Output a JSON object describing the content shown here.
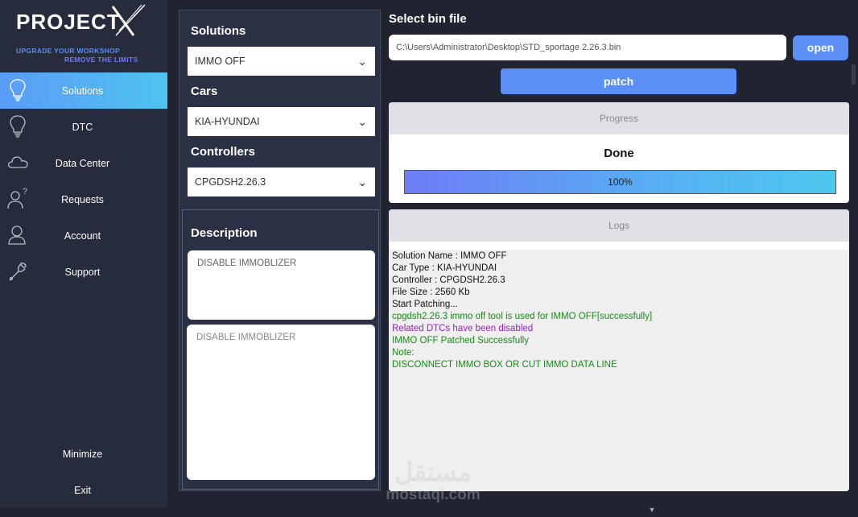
{
  "brand": {
    "title": "PROJECT",
    "tagline1": "UPGRADE YOUR WORKSHOP",
    "tagline2": "REMOVE THE LIMITS",
    "accent": "#5b8ff7"
  },
  "sidebar": {
    "items": [
      {
        "label": "Solutions",
        "icon": "lightbulb-icon",
        "active": true
      },
      {
        "label": "DTC",
        "icon": "lightbulb-icon"
      },
      {
        "label": "Data Center",
        "icon": "cloud-icon"
      },
      {
        "label": "Requests",
        "icon": "user-question-icon"
      },
      {
        "label": "Account",
        "icon": "user-icon"
      },
      {
        "label": "Support",
        "icon": "wrench-icon"
      }
    ],
    "minimize_label": "Minimize",
    "exit_label": "Exit"
  },
  "form": {
    "solutions_label": "Solutions",
    "solutions_value": "IMMO OFF",
    "cars_label": "Cars",
    "cars_value": "KIA-HYUNDAI",
    "controllers_label": "Controllers",
    "controllers_value": "CPGDSH2.26.3",
    "description_label": "Description",
    "description_1": "DISABLE IMMOBLIZER",
    "description_2": "DISABLE IMMOBLIZER"
  },
  "bin": {
    "label": "Select bin file",
    "path": "C:\\Users\\Administrator\\Desktop\\STD_sportage 2.26.3.bin",
    "open_label": "open",
    "patch_label": "patch"
  },
  "progress": {
    "header": "Progress",
    "status": "Done",
    "percent_label": "100%",
    "value": 1.0
  },
  "logs": {
    "header": "Logs",
    "lines": [
      {
        "text": "Solution Name : IMMO OFF",
        "color": "#111111"
      },
      {
        "text": "Car Type : KIA-HYUNDAI",
        "color": "#111111"
      },
      {
        "text": "Controller : CPGDSH2.26.3",
        "color": "#111111"
      },
      {
        "text": "File Size : 2560 Kb",
        "color": "#111111"
      },
      {
        "text": "Start Patching...",
        "color": "#111111"
      },
      {
        "text": "cpgdsh2.26.3 immo off tool  is used for IMMO OFF[successfully]",
        "color": "#1a8a1a"
      },
      {
        "text": "Related DTCs have been disabled",
        "color": "#9b1fc1"
      },
      {
        "text": "IMMO OFF Patched Successfully",
        "color": "#1a8a1a"
      },
      {
        "text": "Note:",
        "color": "#1a8a1a"
      },
      {
        "text": "DISCONNECT IMMO BOX OR CUT IMMO DATA LINE",
        "color": "#1a8a1a"
      }
    ]
  },
  "watermark": {
    "arabic": "مستقل",
    "latin": "mostaql.com"
  }
}
